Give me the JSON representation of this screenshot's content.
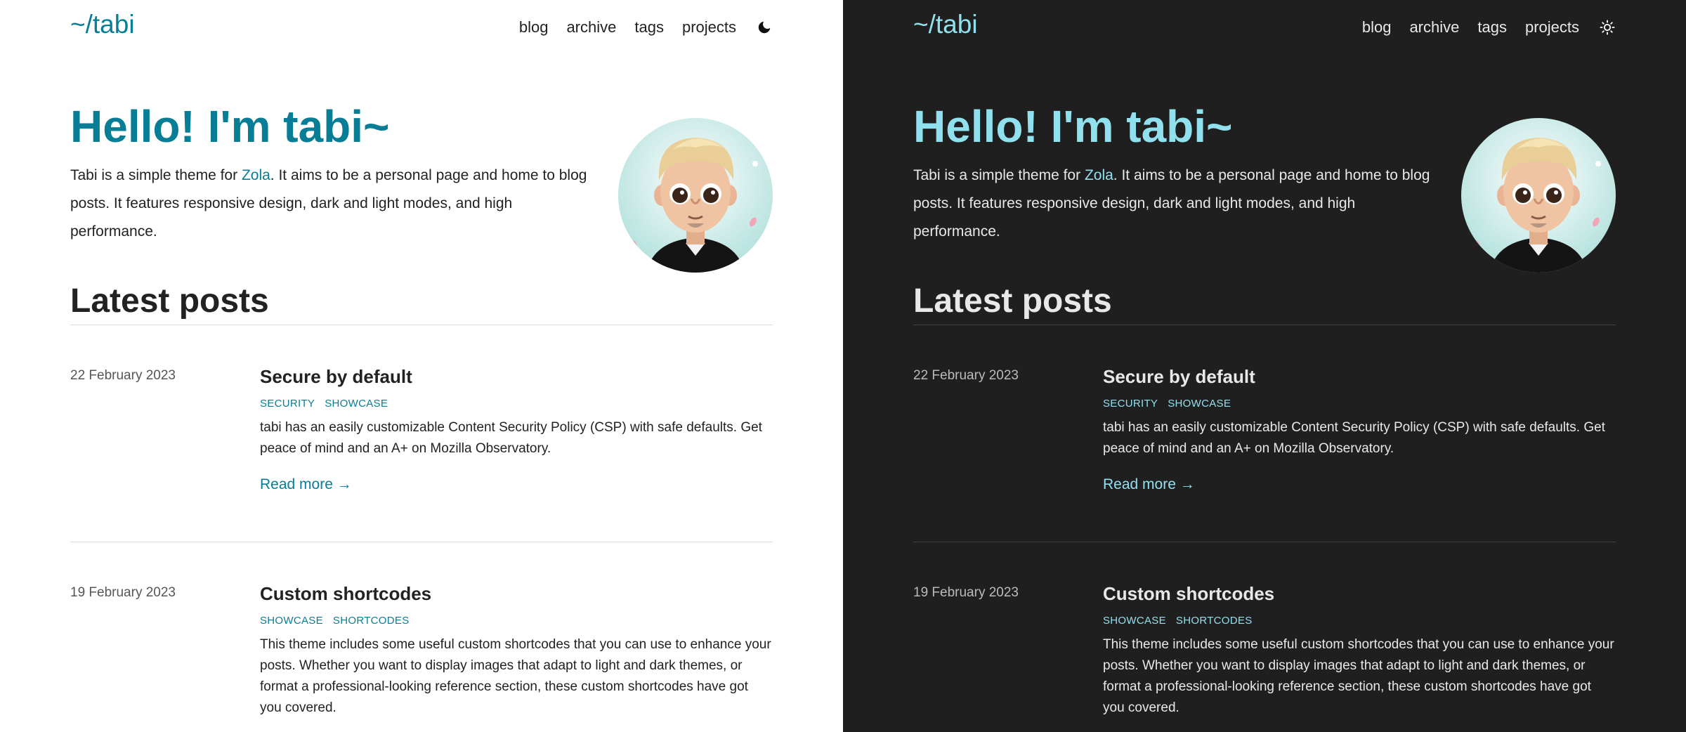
{
  "site": {
    "logo": "~/tabi"
  },
  "nav": {
    "items": [
      "blog",
      "archive",
      "tags",
      "projects"
    ]
  },
  "hero": {
    "title": "Hello! I'm tabi~",
    "intro_before": "Tabi is a simple theme for ",
    "intro_link": "Zola",
    "intro_after": ". It aims to be a personal page and home to blog posts. It features responsive design, dark and light modes, and high performance."
  },
  "section": {
    "title": "Latest posts"
  },
  "posts": [
    {
      "date": "22 February 2023",
      "title": "Secure by default",
      "tags": [
        "SECURITY",
        "SHOWCASE"
      ],
      "summary": "tabi has an easily customizable Content Security Policy (CSP) with safe defaults. Get peace of mind and an A+ on Mozilla Observatory.",
      "read_more": "Read more →"
    },
    {
      "date": "19 February 2023",
      "title": "Custom shortcodes",
      "tags": [
        "SHOWCASE",
        "SHORTCODES"
      ],
      "summary": "This theme includes some useful custom shortcodes that you can use to enhance your posts. Whether you want to display images that adapt to light and dark themes, or format a professional-looking reference section, these custom shortcodes have got you covered."
    }
  ],
  "themes": {
    "light": {
      "background": "#ffffff",
      "text": "#222222",
      "accent": "#087e96",
      "toggle_icon": "moon-icon"
    },
    "dark": {
      "background": "#1f1f1f",
      "text": "#e8e8e8",
      "accent": "#91e0ee",
      "toggle_icon": "sun-icon"
    }
  }
}
